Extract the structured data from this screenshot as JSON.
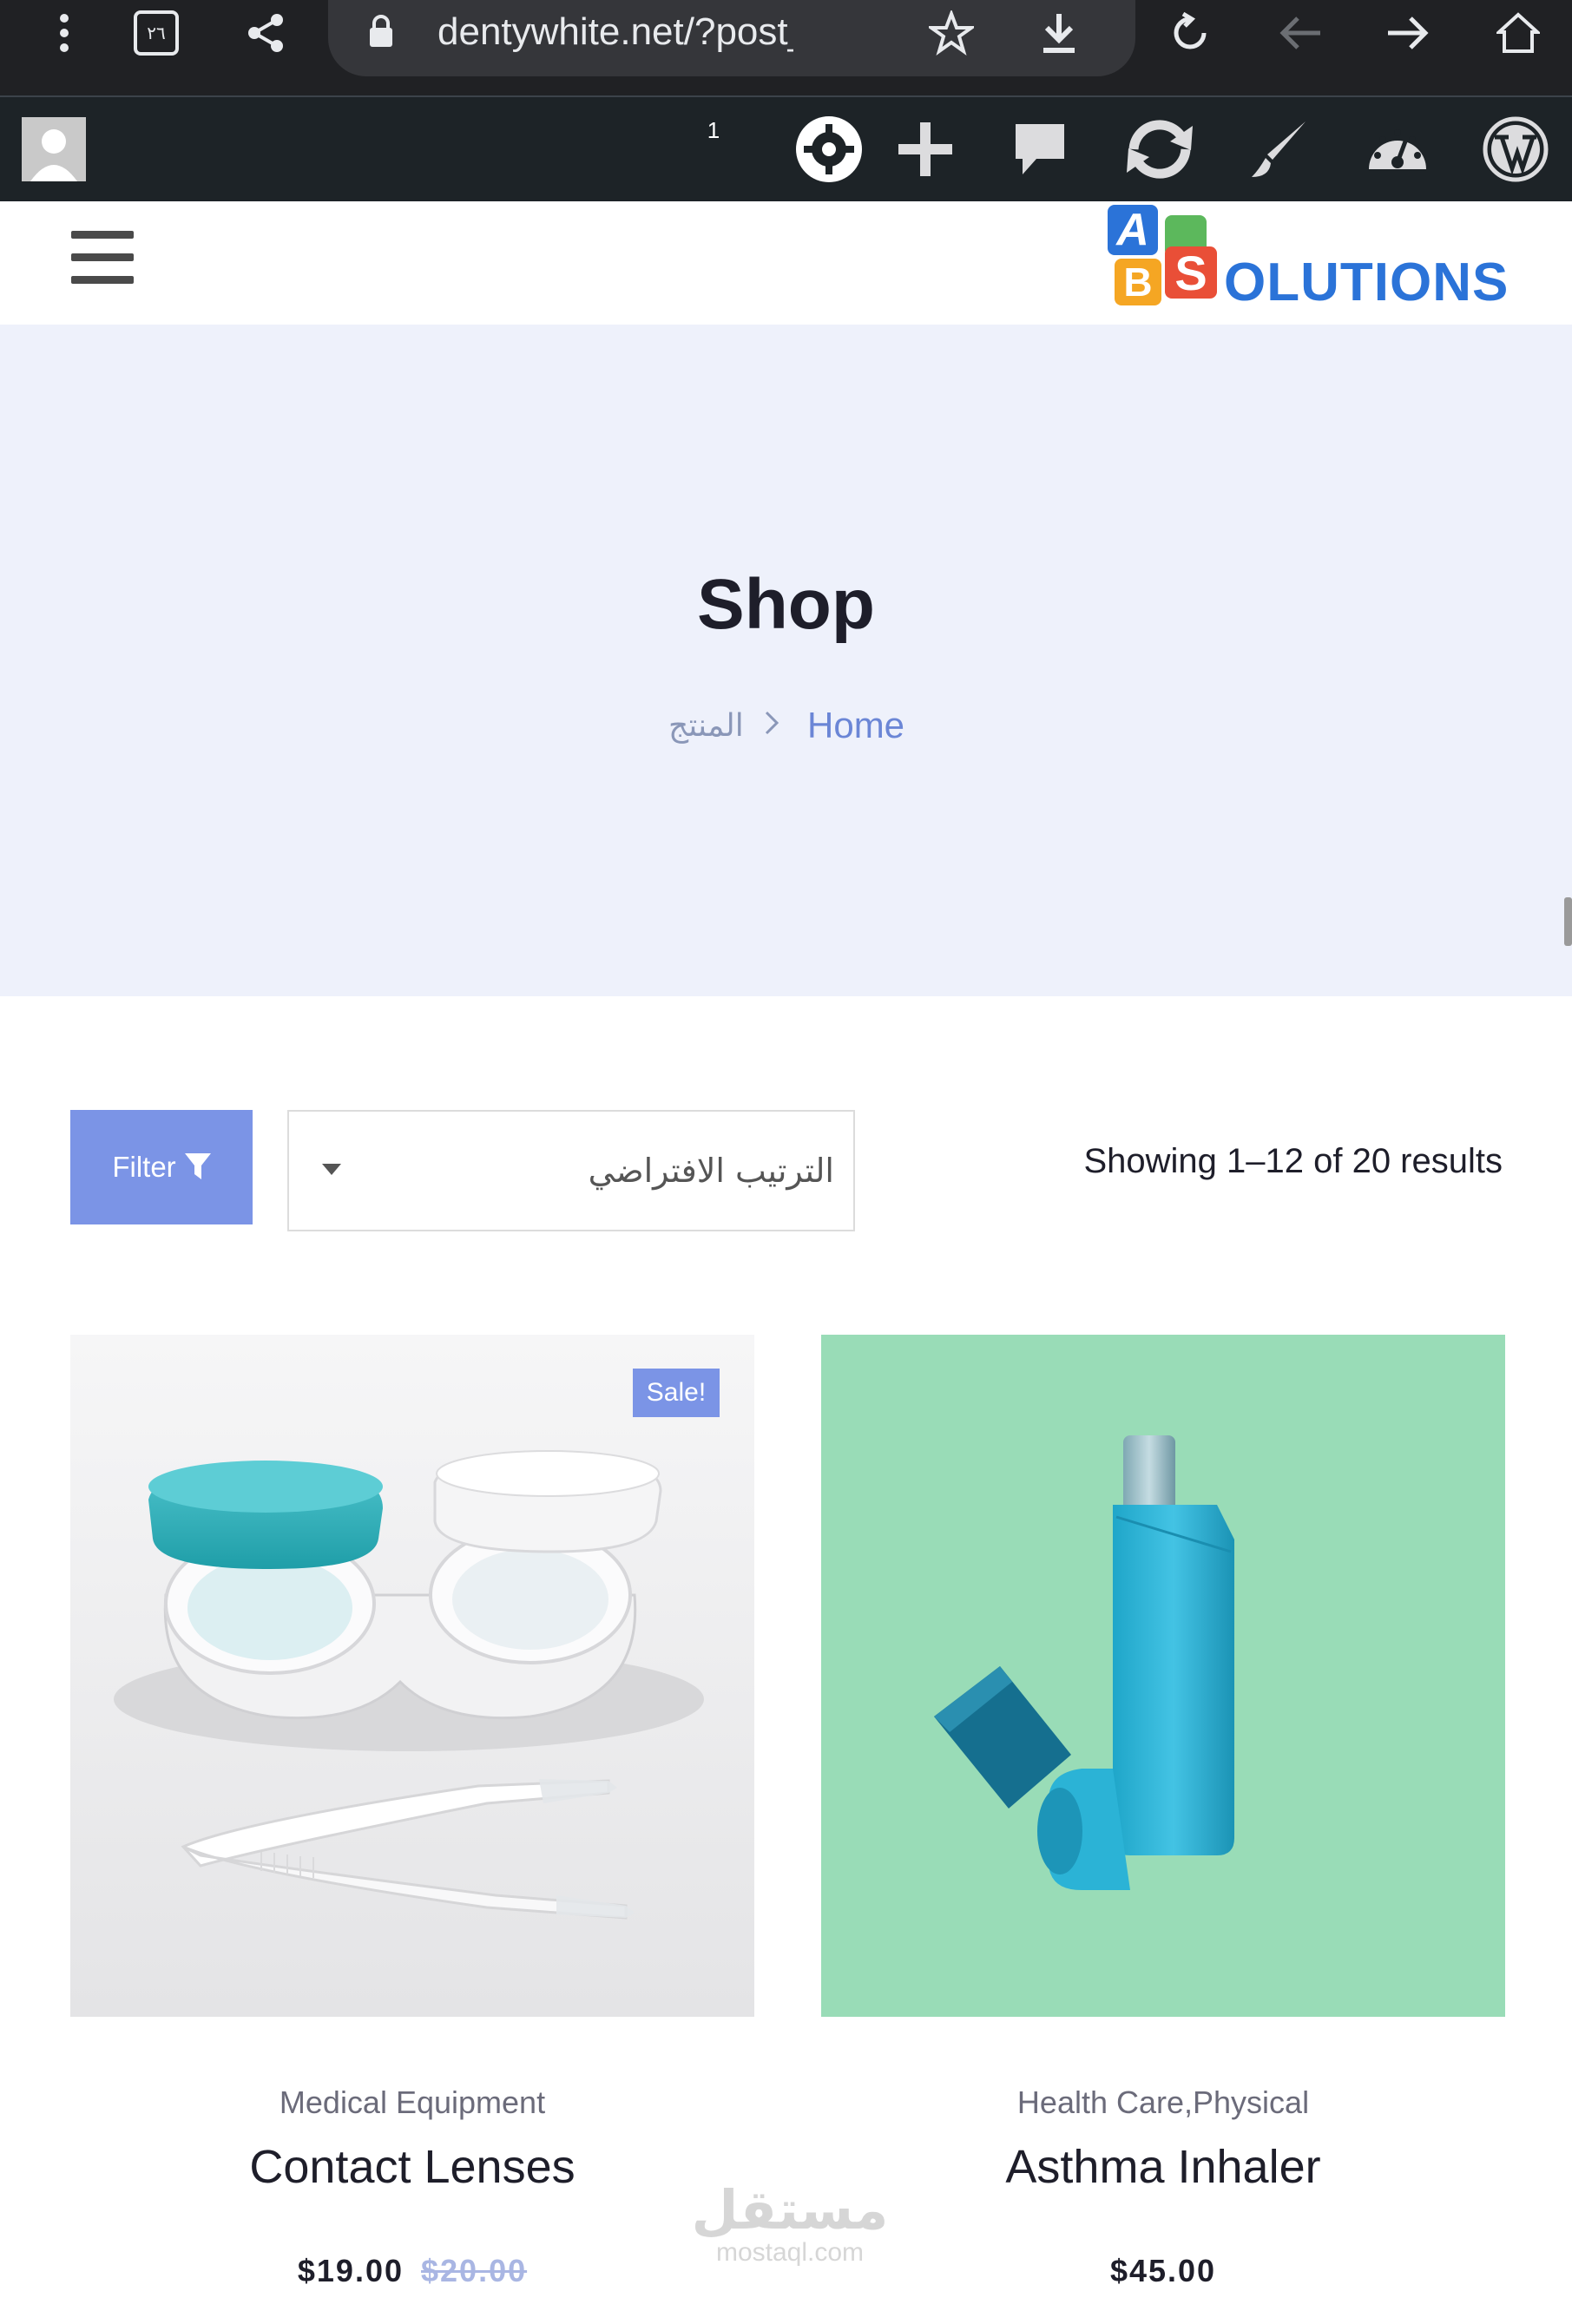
{
  "browser": {
    "tab_count": "٢٦",
    "url": "dentywhite.net/?post_type"
  },
  "admin_bar": {
    "notification_count": "1"
  },
  "brand": {
    "letters": [
      "A",
      "B",
      "S"
    ],
    "wordmark": "OLUTIONS",
    "colors": {
      "a": "#2b73d8",
      "b": "#f5a623",
      "s": "#e94f37",
      "g": "#5cb85c"
    }
  },
  "hero": {
    "title": "Shop",
    "breadcrumb_home": "Home",
    "breadcrumb_current": "المنتج"
  },
  "toolbar": {
    "filter_label": "Filter",
    "sort_selected": "الترتيب الافتراضي",
    "results": "Showing 1–12 of 20 results"
  },
  "products": [
    {
      "category": "Medical Equipment",
      "name": "Contact Lenses",
      "price": "$19.00",
      "old_price": "$20.00",
      "badge": "Sale!"
    },
    {
      "category": "Health Care,Physical",
      "name": "Asthma Inhaler",
      "price": "$45.00"
    }
  ],
  "watermark": {
    "arabic": "مستقل",
    "latin": "mostaql.com"
  },
  "colors": {
    "accent": "#7b94e6",
    "hero_bg": "#eef1fb",
    "admin_bg": "#1d2327"
  }
}
